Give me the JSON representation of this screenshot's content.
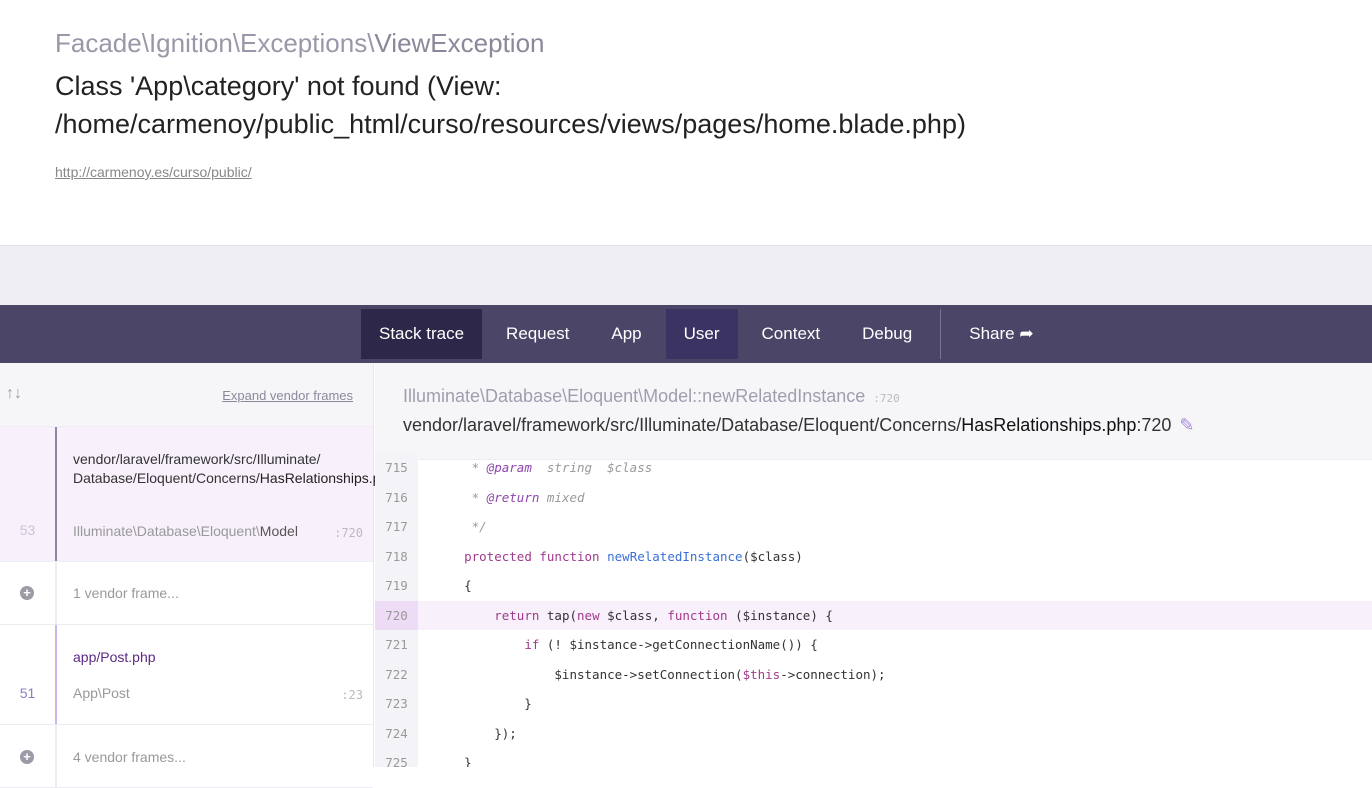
{
  "header": {
    "exception_prefix": "Facade\\Ignition\\Exceptions\\",
    "exception_class": "ViewException",
    "message": "Class 'App\\category' not found (View: /home/carmenoy/public_html/curso/resources/views/pages/home.blade.php)",
    "url": "http://carmenoy.es/curso/public/"
  },
  "nav": {
    "tabs": [
      "Stack trace",
      "Request",
      "App",
      "User",
      "Context",
      "Debug"
    ],
    "share": "Share"
  },
  "left": {
    "arrows": "↑↓",
    "expand": "Expand vendor frames",
    "frames": [
      {
        "num": "53",
        "path_dir": "vendor/laravel/framework/src/Illuminate/ Database/Eloquent/Concerns/",
        "path_file": "HasRelationships.php",
        "class_ns": "Illuminate\\Database\\Eloquent\\",
        "class_name": "Model",
        "line": ":720"
      },
      {
        "vendor": "1 vendor frame..."
      },
      {
        "num": "51",
        "path_dir": "app/",
        "path_file": "Post.php",
        "class_ns": "App\\",
        "class_name": "Post",
        "line": ":23"
      },
      {
        "vendor": "4 vendor frames..."
      }
    ]
  },
  "right": {
    "function_ns": "Illuminate\\Database\\Eloquent\\",
    "function_name": "Model::newRelatedInstance",
    "function_line": ":720",
    "file_dir": "vendor/laravel/framework/src/Illuminate/Database/Eloquent/Concerns/",
    "file_name": "HasRelationships.php",
    "file_line": ":720",
    "code": [
      {
        "n": "715",
        "t": "     * @param  string  $class"
      },
      {
        "n": "716",
        "t": "     * @return mixed"
      },
      {
        "n": "717",
        "t": "     */"
      },
      {
        "n": "718",
        "t": "    protected function newRelatedInstance($class)"
      },
      {
        "n": "719",
        "t": "    {"
      },
      {
        "n": "720",
        "t": "        return tap(new $class, function ($instance) {"
      },
      {
        "n": "721",
        "t": "            if (! $instance->getConnectionName()) {"
      },
      {
        "n": "722",
        "t": "                $instance->setConnection($this->connection);"
      },
      {
        "n": "723",
        "t": "            }"
      },
      {
        "n": "724",
        "t": "        });"
      },
      {
        "n": "725",
        "t": "    }"
      }
    ],
    "highlight_line": "720"
  },
  "colors": {
    "nav": "#4b4567",
    "active_tab": "#2d2849",
    "highlight": "#f8f1fb"
  }
}
